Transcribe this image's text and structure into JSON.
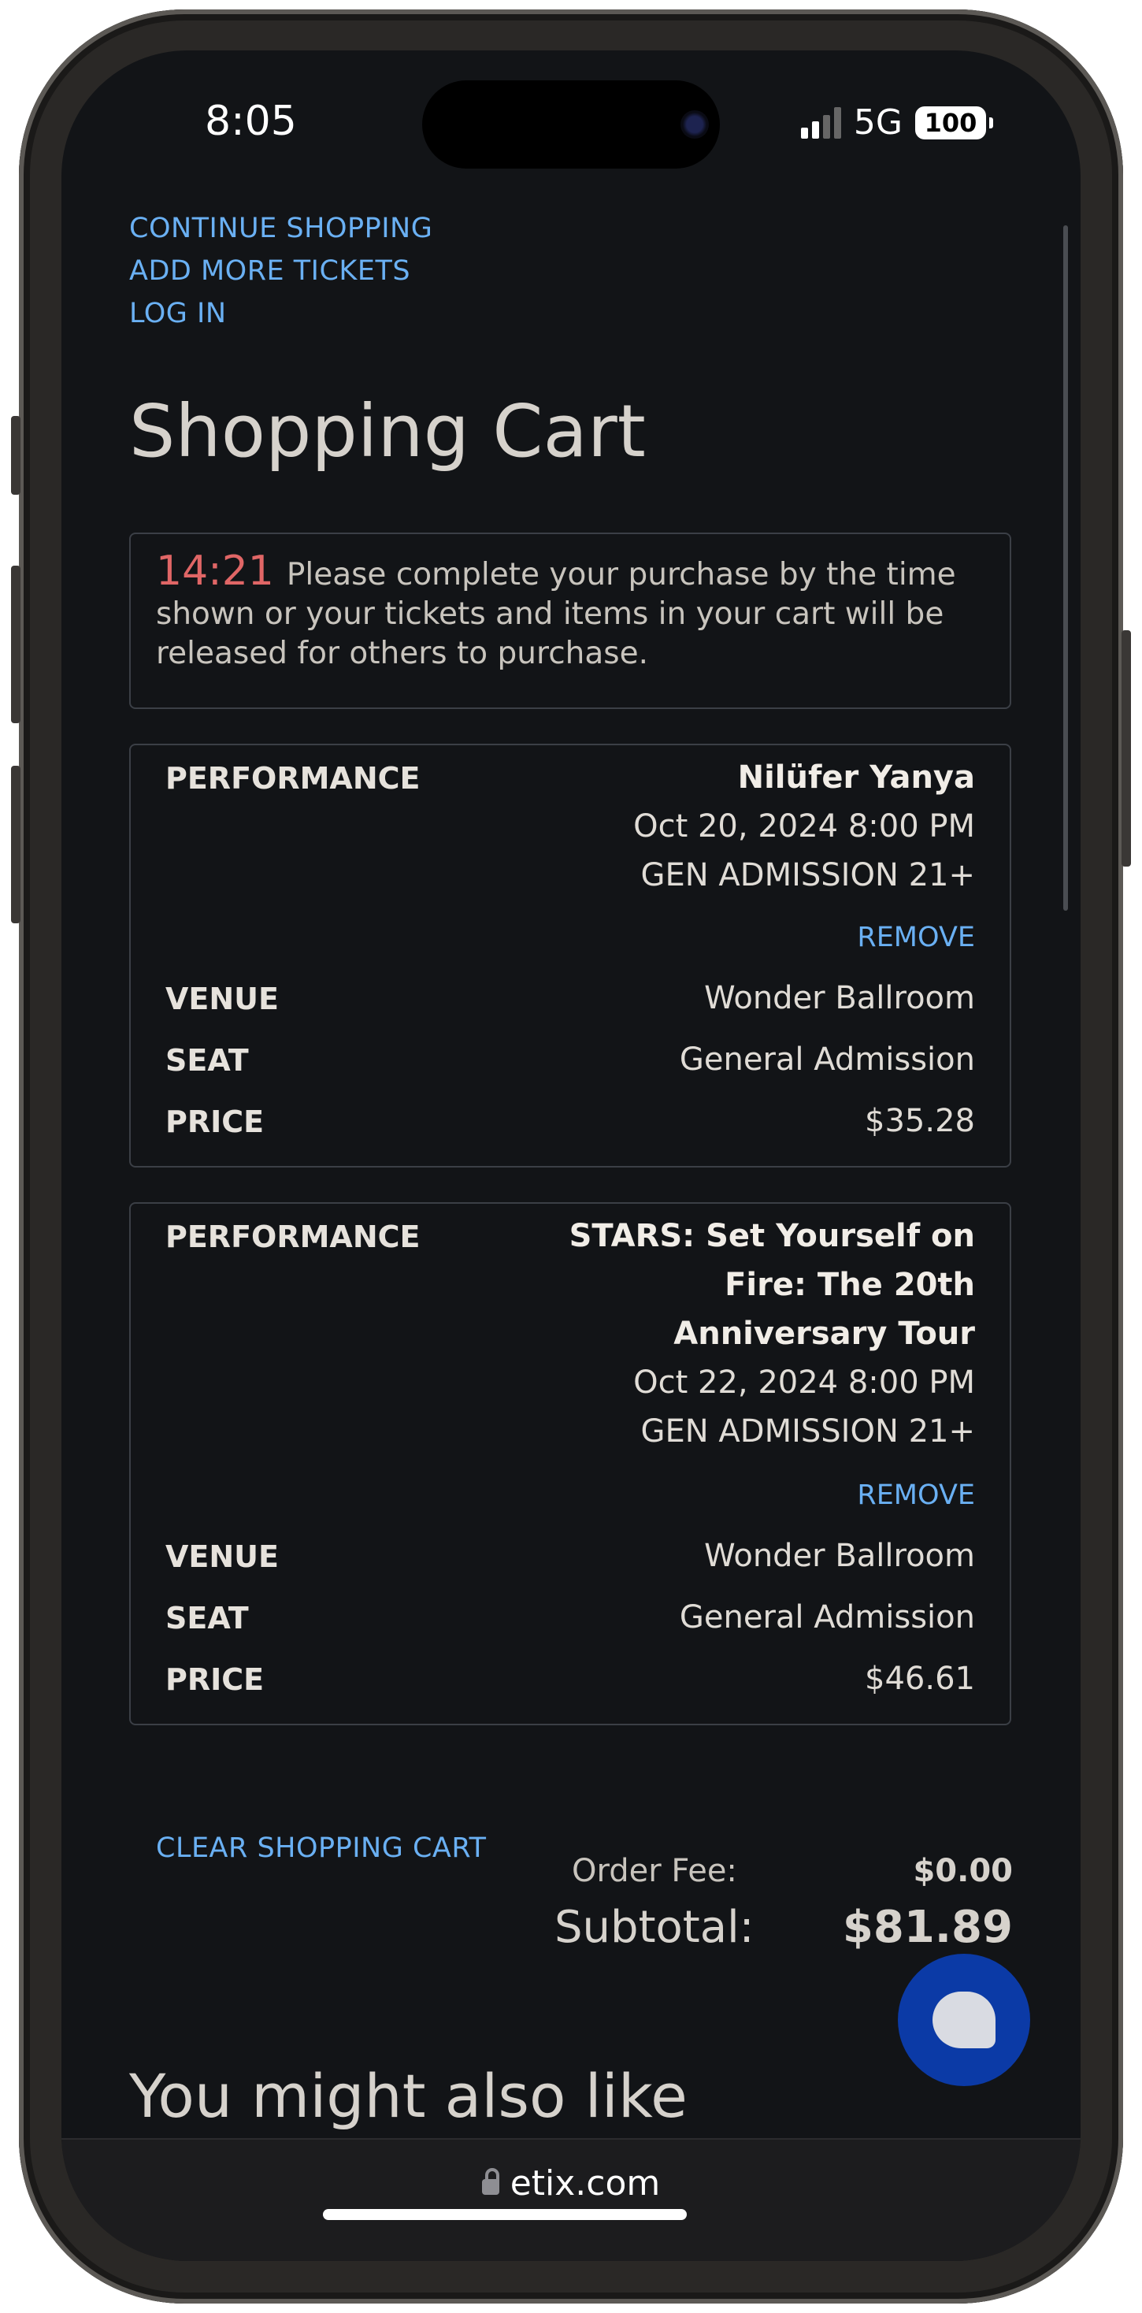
{
  "status_bar": {
    "time": "8:05",
    "network": "5G",
    "battery": "100"
  },
  "nav_links": [
    "CONTINUE SHOPPING",
    "ADD MORE TICKETS",
    "LOG IN"
  ],
  "page_title": "Shopping Cart",
  "timer": {
    "countdown": "14:21",
    "message": "Please complete your purchase by the time shown or your tickets and items in your cart will be released for others to purchase."
  },
  "labels": {
    "performance": "PERFORMANCE",
    "venue": "VENUE",
    "seat": "SEAT",
    "price": "PRICE",
    "remove": "REMOVE"
  },
  "items": [
    {
      "title_lines": [
        "Nilüfer Yanya"
      ],
      "date": "Oct 20, 2024 8:00 PM",
      "admission": "GEN ADMISSION 21+",
      "venue": "Wonder Ballroom",
      "seat": "General Admission",
      "price": "$35.28"
    },
    {
      "title_lines": [
        "STARS: Set Yourself on",
        "Fire: The 20th",
        "Anniversary Tour"
      ],
      "date": "Oct 22, 2024 8:00 PM",
      "admission": "GEN ADMISSION 21+",
      "venue": "Wonder Ballroom",
      "seat": "General Admission",
      "price": "$46.61"
    }
  ],
  "clear_cart": "CLEAR SHOPPING CART",
  "totals": {
    "order_fee_label": "Order Fee:",
    "order_fee": "$0.00",
    "subtotal_label": "Subtotal:",
    "subtotal": "$81.89"
  },
  "recommendations_title": "You might also like",
  "url": "etix.com"
}
